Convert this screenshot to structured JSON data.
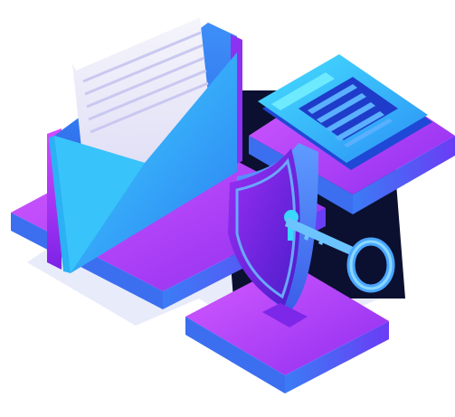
{
  "illustration": {
    "elements": [
      "envelope-icon",
      "document-icon",
      "credit-card-icon",
      "shield-icon",
      "key-icon",
      "platform"
    ]
  },
  "colors": {
    "background": "#ffffff",
    "purple": "#b13cf0",
    "purple_dark": "#7a1fd0",
    "blue": "#2f6bf0",
    "cyan": "#38d6ff",
    "navy": "#0b1030",
    "shadow": "#dfe4f8",
    "paper": "#ececf7",
    "paper_line": "#c9c8f0"
  }
}
